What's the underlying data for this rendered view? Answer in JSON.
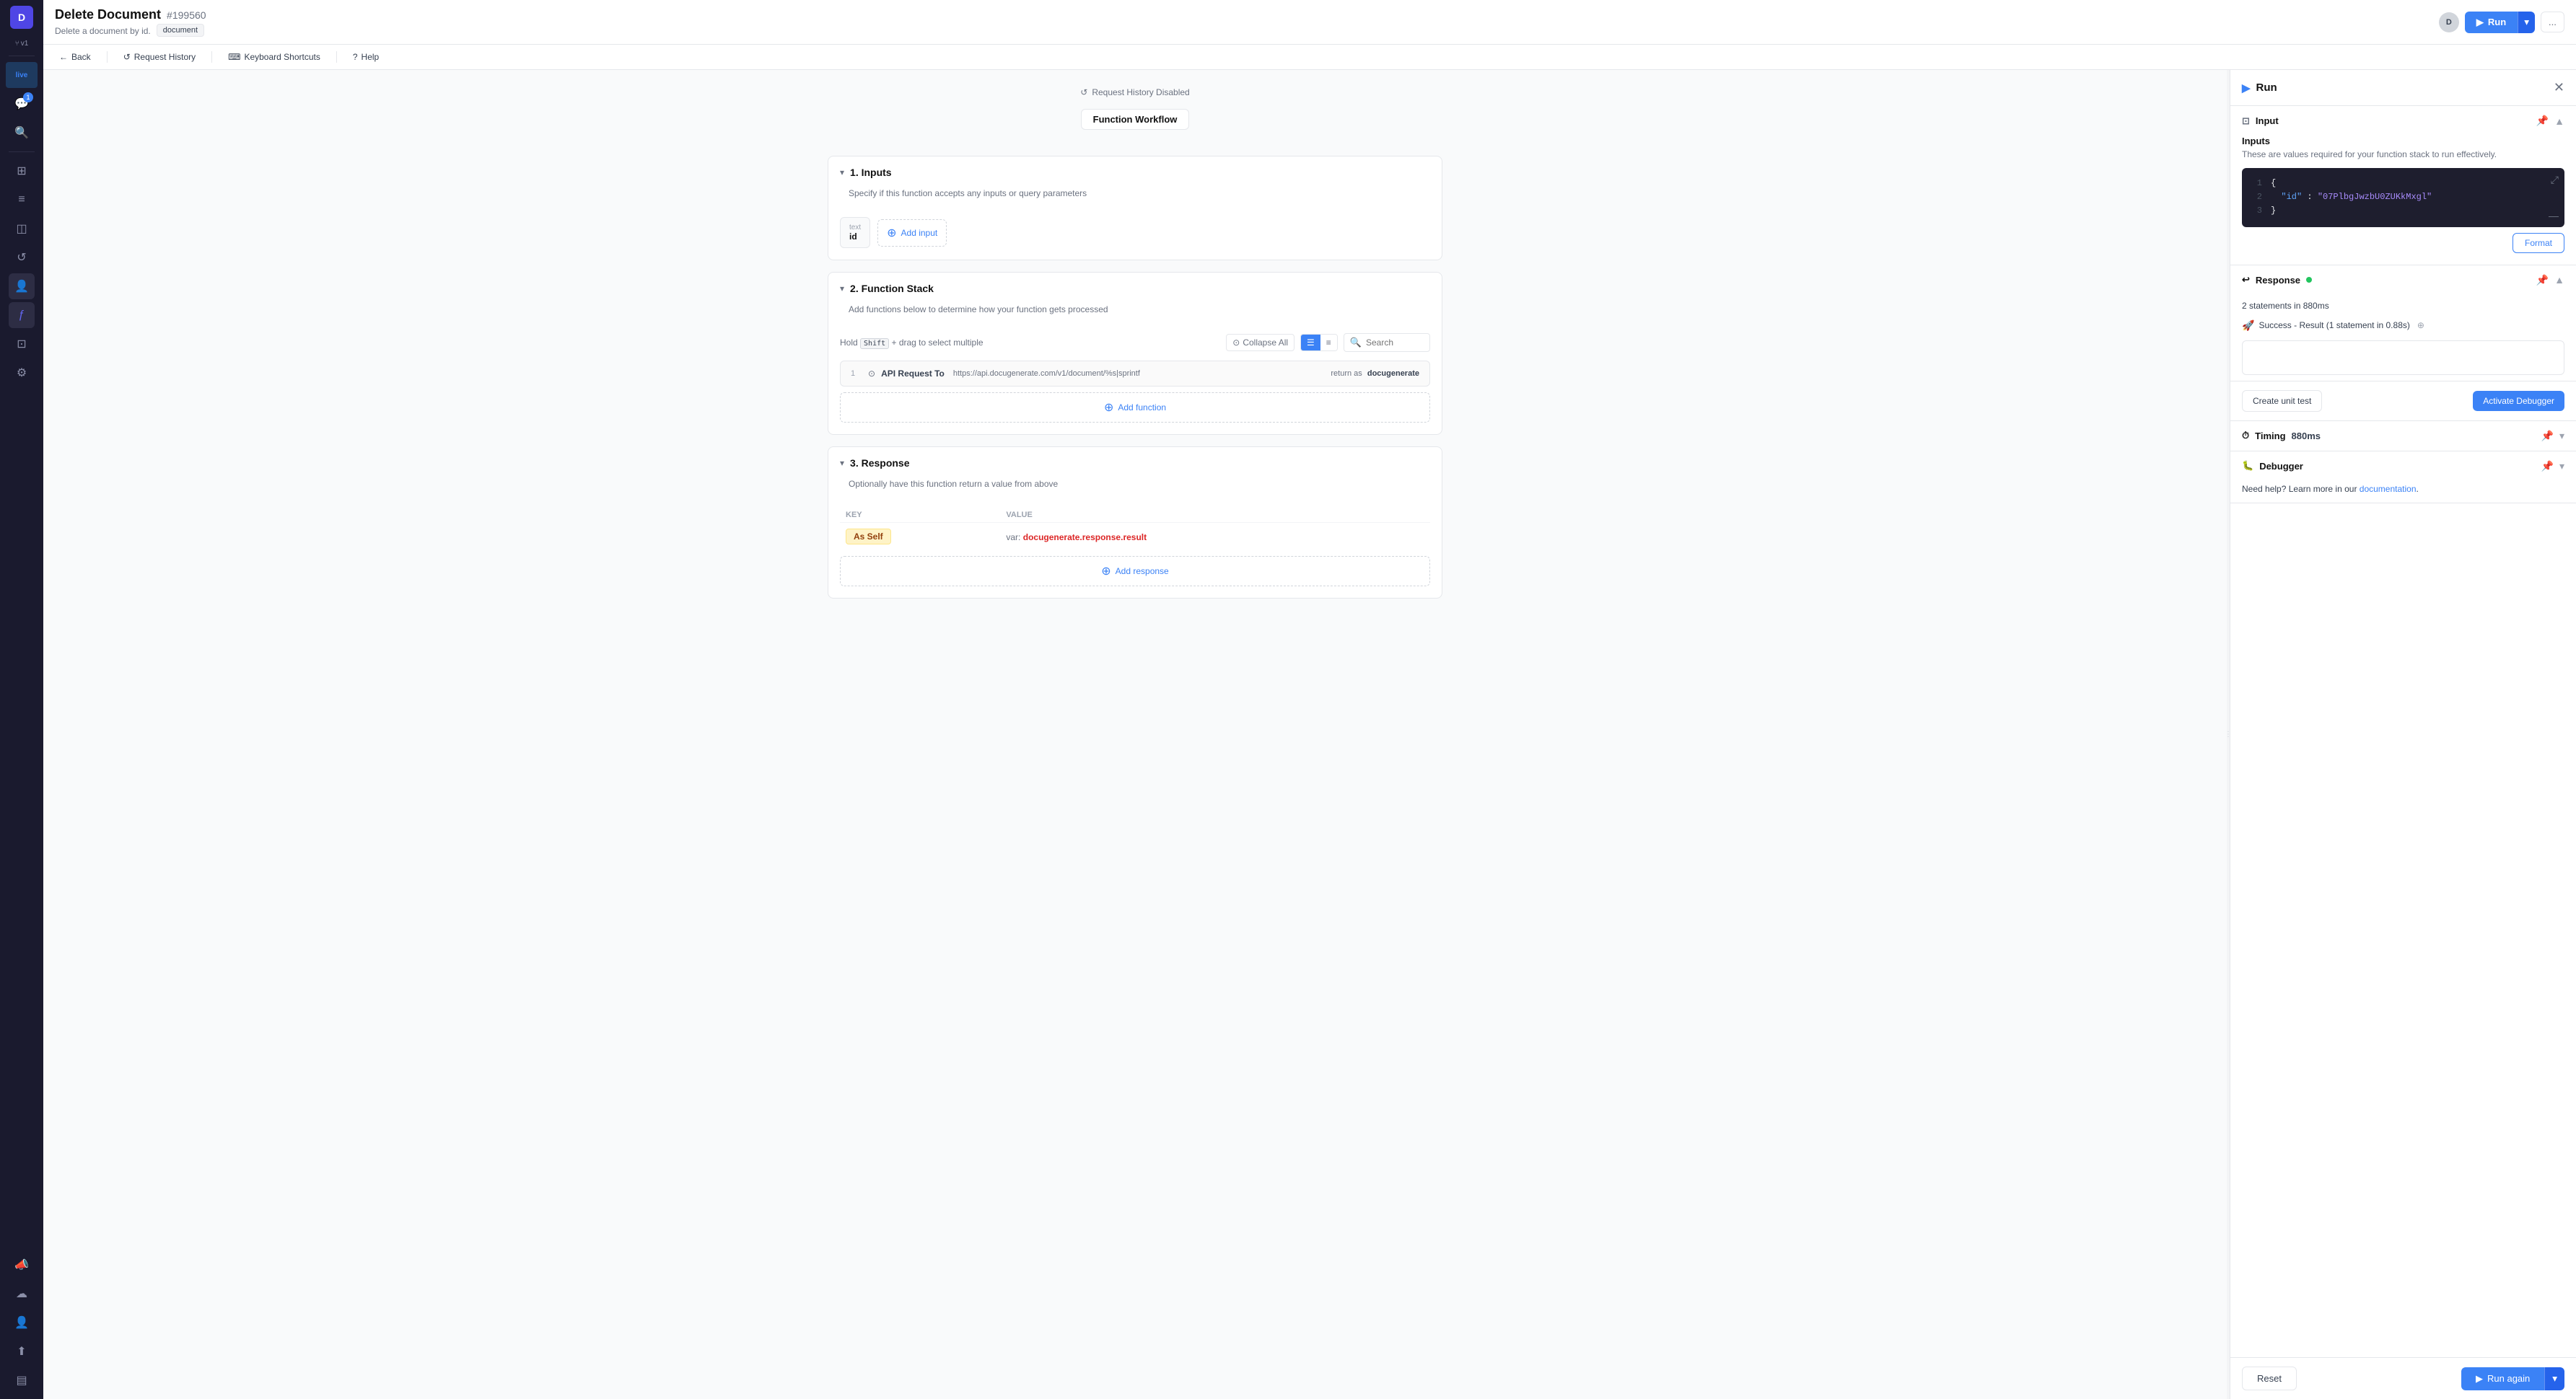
{
  "app": {
    "title": "Delete Document",
    "id": "#199560",
    "subtitle": "Delete a document by id.",
    "tag": "document",
    "version": "v1",
    "live_badge": "live"
  },
  "header": {
    "avatar_letter": "D",
    "user_avatar": "D",
    "run_label": "Run",
    "more_label": "..."
  },
  "toolbar": {
    "back_label": "Back",
    "request_history_label": "Request History",
    "keyboard_shortcuts_label": "Keyboard Shortcuts",
    "help_label": "Help"
  },
  "workflow": {
    "notice": "Request History Disabled",
    "title": "Function Workflow",
    "sections": {
      "inputs": {
        "title": "1. Inputs",
        "desc": "Specify if this function accepts any inputs or query parameters",
        "input_type": "text",
        "input_name": "id",
        "add_input_label": "Add input"
      },
      "function_stack": {
        "title": "2. Function Stack",
        "desc": "Add functions below to determine how your function gets processed",
        "hold_text": "Hold",
        "shift_key": "Shift",
        "drag_text": "+ drag to select multiple",
        "collapse_all_label": "Collapse All",
        "search_placeholder": "Search",
        "view_grid": "☰",
        "view_list": "≡",
        "function": {
          "number": "1",
          "icon": "⊙",
          "label": "API Request To",
          "url": "https://api.docugenerate.com/v1/document/%s|sprintf",
          "return_label": "return as",
          "return_value": "docugenerate"
        },
        "add_function_label": "Add function"
      },
      "response": {
        "title": "3. Response",
        "desc": "Optionally have this function return a value from above",
        "key_header": "KEY",
        "value_header": "VALUE",
        "key_value": "As Self",
        "var_prefix": "var:",
        "var_value": "docugenerate.response.result",
        "add_response_label": "Add response"
      }
    }
  },
  "run_panel": {
    "title": "Run",
    "close_label": "✕",
    "input_section": {
      "title": "Input",
      "inputs_heading": "Inputs",
      "inputs_desc": "These are values required for your function stack to run effectively.",
      "code": {
        "line1": "{",
        "line2_key": "\"id\"",
        "line2_colon": ":",
        "line2_value": "\"07PlbgJwzbU0ZUKkMxgl\"",
        "line3": "}"
      },
      "format_label": "Format"
    },
    "response_section": {
      "title": "Response",
      "status_text": "2 statements in 880ms",
      "success_text": "Success - Result (1 statement in 0.88s)",
      "create_unit_label": "Create unit test",
      "activate_debugger_label": "Activate Debugger"
    },
    "timing_section": {
      "title": "Timing",
      "value": "880ms"
    },
    "debugger_section": {
      "title": "Debugger"
    },
    "help_text": "Need help? Learn more in our",
    "doc_link_label": "documentation",
    "reset_label": "Reset",
    "run_again_label": "Run again"
  },
  "sidebar": {
    "avatar": "D",
    "version": "v1",
    "live": "live",
    "items": [
      {
        "icon": "⊞",
        "name": "dashboard"
      },
      {
        "icon": "▬",
        "name": "functions"
      },
      {
        "icon": "◫",
        "name": "layers"
      },
      {
        "icon": "↺",
        "name": "history"
      },
      {
        "icon": "👤",
        "name": "user-functions",
        "active": true
      },
      {
        "icon": "ƒ",
        "name": "function-editor",
        "active": true
      },
      {
        "icon": "⊡",
        "name": "packages"
      },
      {
        "icon": "⚙",
        "name": "settings"
      }
    ],
    "bottom_items": [
      {
        "icon": "📣",
        "name": "announcements"
      },
      {
        "icon": "☁",
        "name": "integrations"
      },
      {
        "icon": "👤",
        "name": "profile"
      },
      {
        "icon": "⬆",
        "name": "upload"
      },
      {
        "icon": "▤",
        "name": "sidebar-toggle"
      }
    ],
    "notification_count": "1"
  }
}
